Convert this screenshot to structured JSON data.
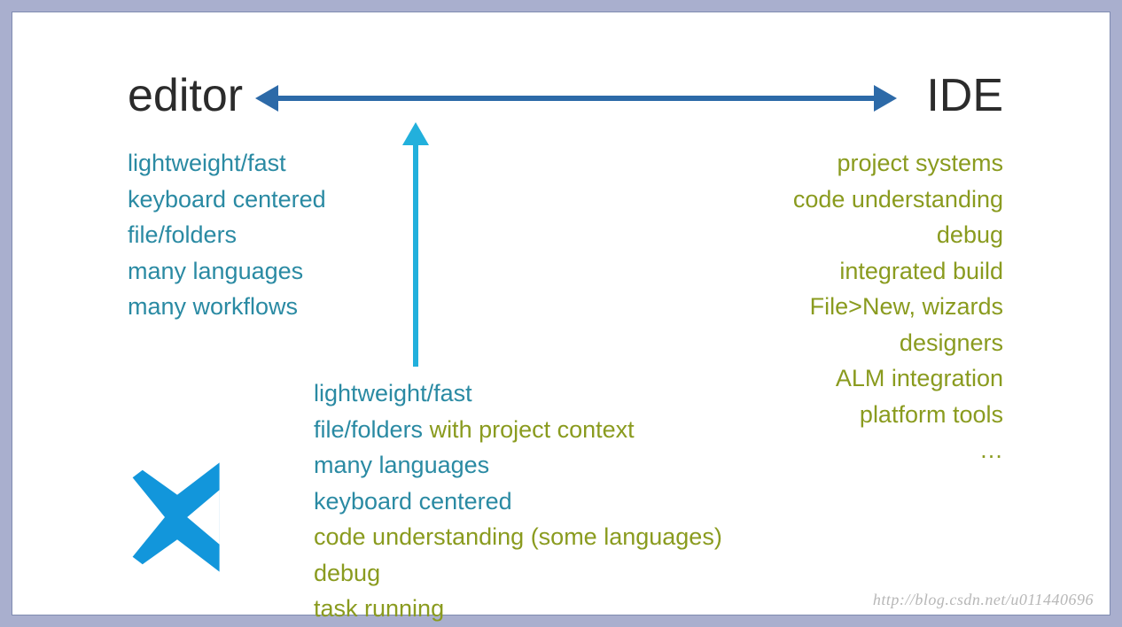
{
  "headings": {
    "left": "editor",
    "right": "IDE"
  },
  "editor_col": {
    "i0": "lightweight/fast",
    "i1": "keyboard centered",
    "i2": "file/folders",
    "i3": "many languages",
    "i4": "many workflows"
  },
  "ide_col": {
    "i0": "project systems",
    "i1": "code understanding",
    "i2": "debug",
    "i3": "integrated build",
    "i4": "File>New, wizards",
    "i5": "designers",
    "i6": "ALM integration",
    "i7": "platform tools",
    "i8": "…"
  },
  "mid_col": {
    "l0a": "lightweight/fast",
    "l1a": "file/folders",
    "l1b": " with project context",
    "l2a": "many languages",
    "l3a": "keyboard centered",
    "l4a": "code understanding (some languages)",
    "l5a": "debug",
    "l6a": "task running"
  },
  "watermark": "http://blog.csdn.net/u011440696",
  "colors": {
    "border": "#a9afce",
    "spectrum_arrow": "#2d6aa8",
    "vertical_arrow": "#22b0dc",
    "teal_text": "#2a8aa3",
    "olive_text": "#8a9b1f",
    "logo": "#1296db"
  }
}
